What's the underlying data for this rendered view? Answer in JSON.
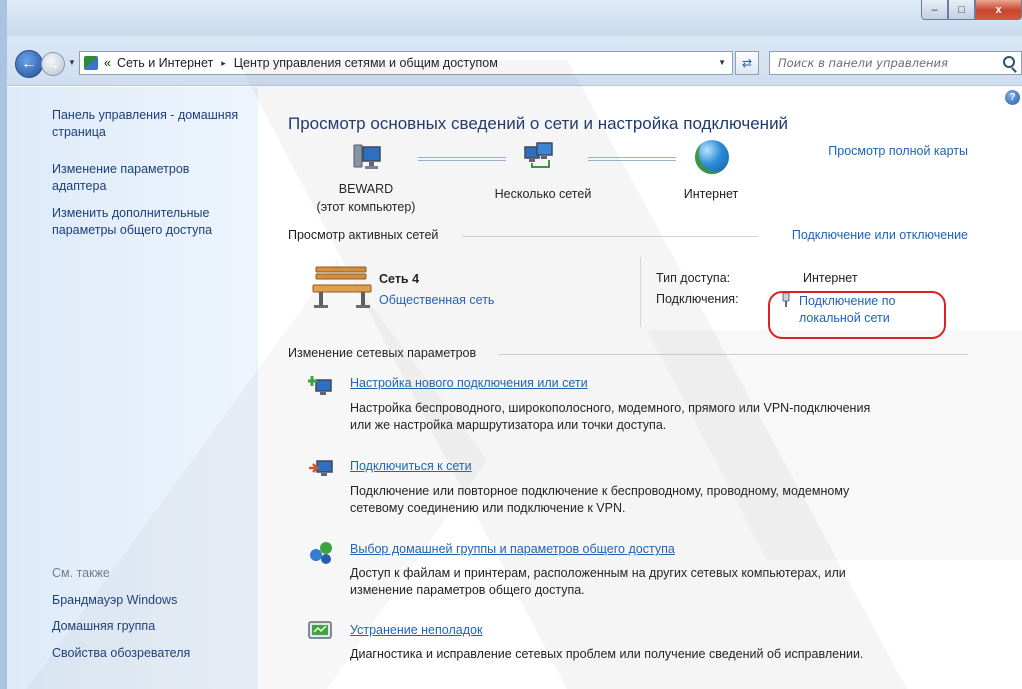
{
  "window": {
    "caption_min": "–",
    "caption_max": "□",
    "caption_close": "x"
  },
  "address": {
    "chevron": "«",
    "crumb1": "Сеть и Интернет",
    "crumb_sep": "▸",
    "crumb2": "Центр управления сетями и общим доступом",
    "search_placeholder": "Поиск в панели управления"
  },
  "sidebar": {
    "home": "Панель управления - домашняя страница",
    "adapter": "Изменение параметров адаптера",
    "sharing": "Изменить дополнительные параметры общего доступа",
    "see_also": "См. также",
    "firewall": "Брандмауэр Windows",
    "homegroup": "Домашняя группа",
    "browser": "Свойства обозревателя"
  },
  "main": {
    "title": "Просмотр основных сведений о сети и настройка подключений",
    "full_map": "Просмотр полной карты",
    "node_pc_name": "BEWARD",
    "node_pc_sub": "(этот компьютер)",
    "node_multi": "Несколько сетей",
    "node_internet": "Интернет",
    "active_networks": "Просмотр активных сетей",
    "connect_disconnect": "Подключение или отключение",
    "network_name": "Сеть  4",
    "network_type": "Общественная сеть",
    "access_type_label": "Тип доступа:",
    "access_type_value": "Интернет",
    "connections_label": "Подключения:",
    "connection_line1": "Подключение по",
    "connection_line2": "локальной сети",
    "change_settings": "Изменение сетевых параметров",
    "tasks": [
      {
        "title": "Настройка нового подключения или сети",
        "desc1": "Настройка беспроводного, широкополосного, модемного, прямого или VPN-подключения",
        "desc2": "или же настройка маршрутизатора или точки доступа."
      },
      {
        "title": "Подключиться к сети",
        "desc1": "Подключение или повторное подключение к беспроводному, проводному, модемному",
        "desc2": "сетевому соединению или подключение к VPN."
      },
      {
        "title": "Выбор домашней группы и параметров общего доступа",
        "desc1": "Доступ к файлам и принтерам, расположенным на других сетевых компьютерах, или",
        "desc2": "изменение параметров общего доступа."
      },
      {
        "title": "Устранение неполадок",
        "desc1": "Диагностика и исправление сетевых проблем или получение сведений об исправлении."
      }
    ]
  },
  "colors": {
    "link": "#1d63b8",
    "title": "#1e3a6e",
    "highlight": "#e02020"
  }
}
